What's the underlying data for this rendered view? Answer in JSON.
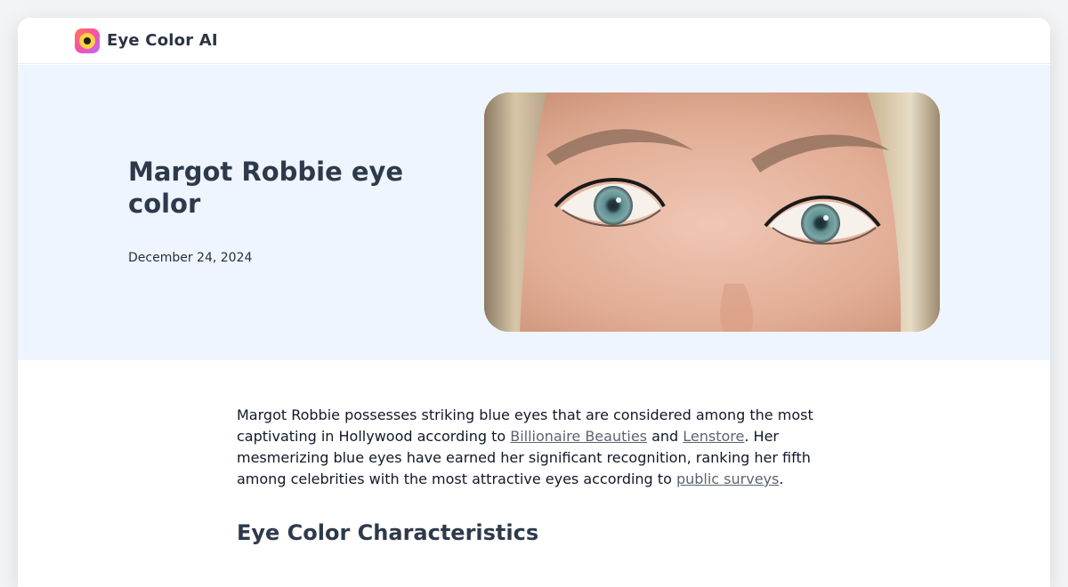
{
  "site": {
    "brand": "Eye Color AI",
    "logo_icon": "eye-logo-icon"
  },
  "hero": {
    "title": "Margot Robbie eye color",
    "date": "December 24, 2024",
    "image_alt": "Close-up of Margot Robbie's blue eyes"
  },
  "article": {
    "intro": {
      "text1": "Margot Robbie possesses striking blue eyes that are considered among the most captivating in Hollywood according to ",
      "link1": "Billionaire Beauties",
      "text2": " and ",
      "link2": "Lenstore",
      "text3": ". Her mesmerizing blue eyes have earned her significant recognition, ranking her fifth among celebrities with the most attractive eyes according to ",
      "link3": "public surveys",
      "text4": "."
    },
    "section_heading": "Eye Color Characteristics"
  },
  "colors": {
    "hero_bg": "#eef5ff",
    "heading": "#2e3a4b",
    "link": "#5b6472"
  }
}
